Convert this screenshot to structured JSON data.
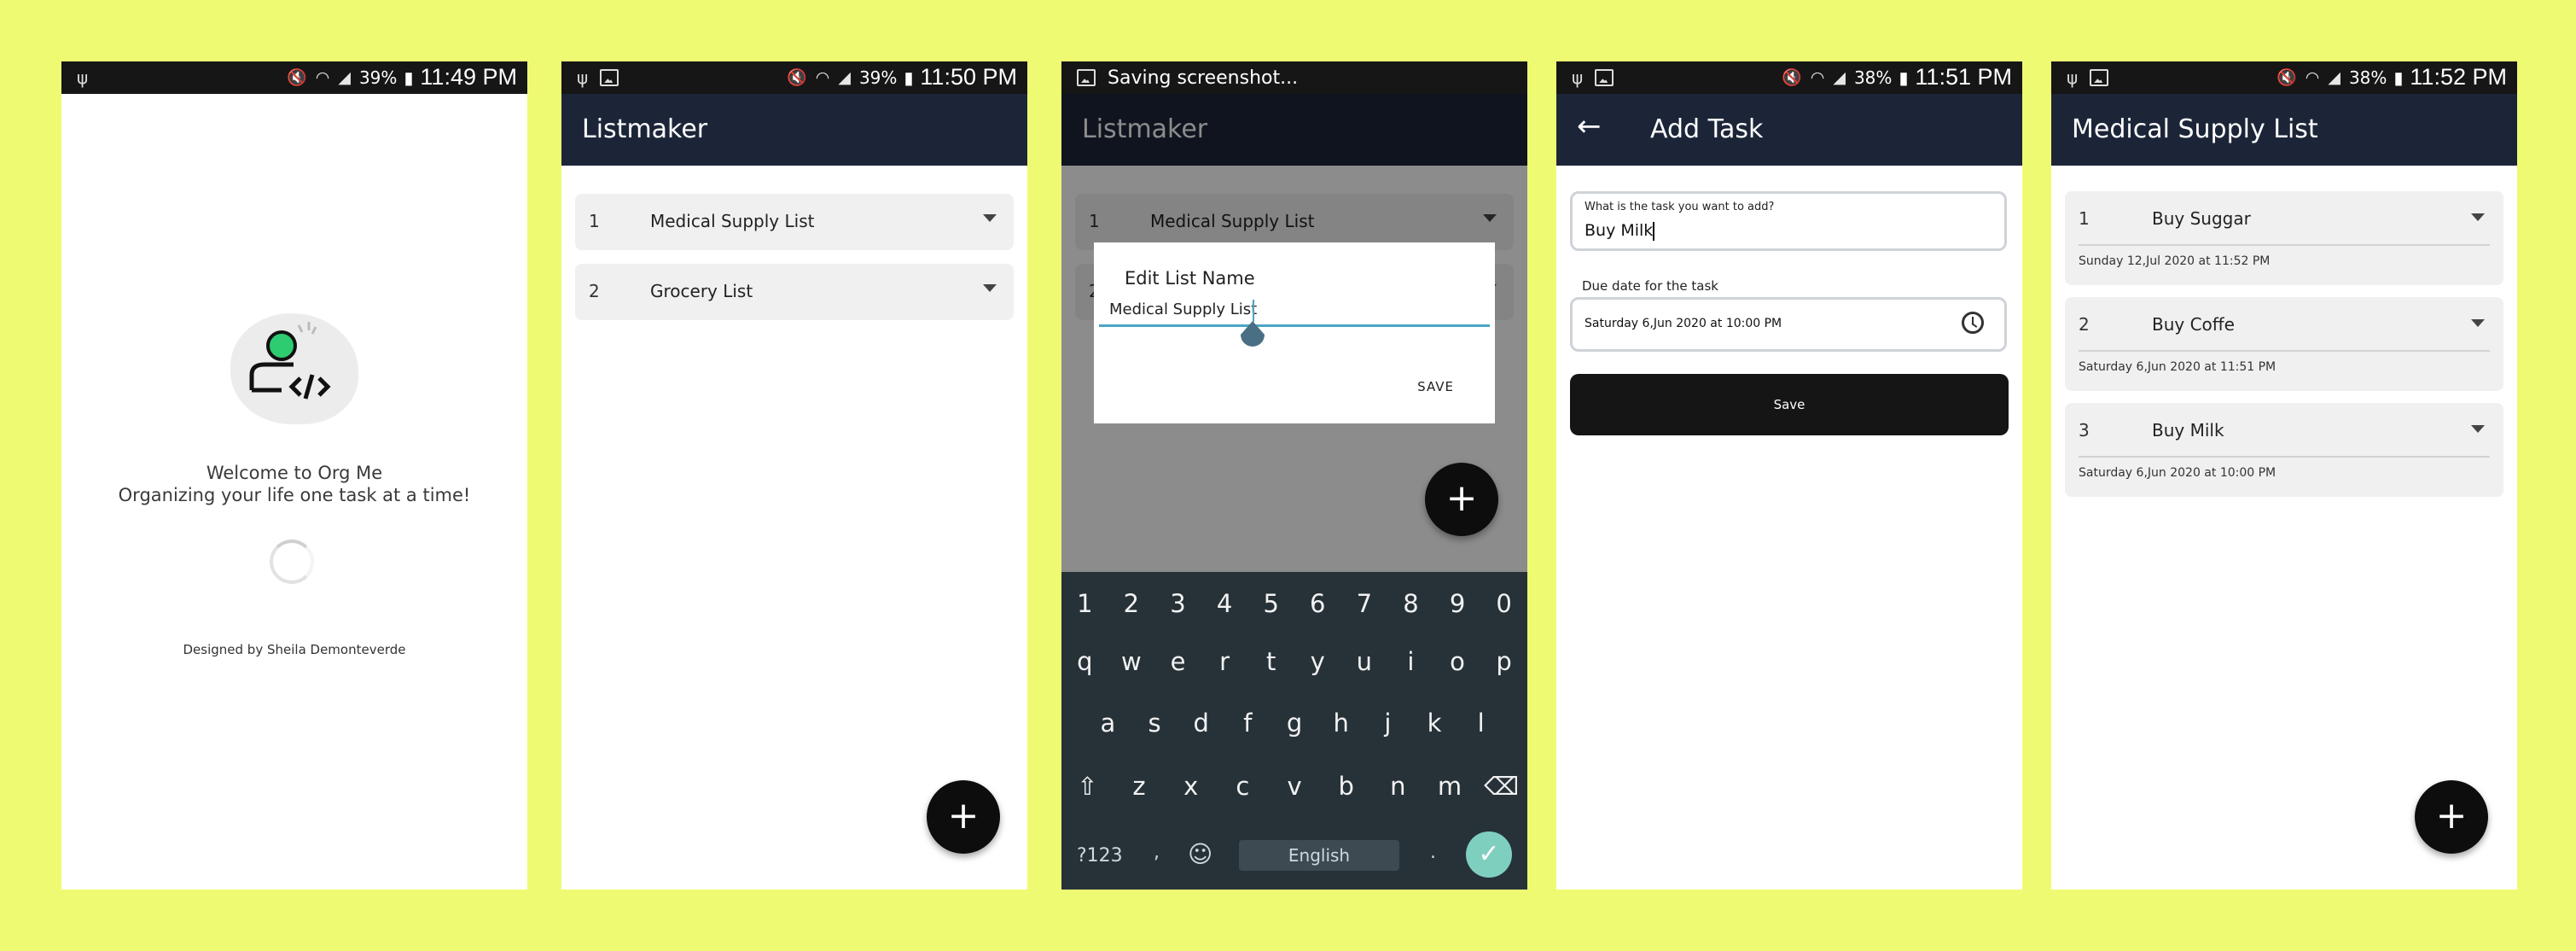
{
  "screen1": {
    "status": {
      "battery": "39%",
      "time": "11:49 PM"
    },
    "welcome_line1": "Welcome to Org Me",
    "welcome_line2": "Organizing your life one task at a time!",
    "designed_by": "Designed by Sheila Demonteverde"
  },
  "screen2": {
    "status": {
      "battery": "39%",
      "time": "11:50 PM"
    },
    "title": "Listmaker",
    "lists": [
      {
        "num": "1",
        "name": "Medical Supply List"
      },
      {
        "num": "2",
        "name": "Grocery List"
      }
    ],
    "fab": "+"
  },
  "screen3": {
    "status_text": "Saving screenshot...",
    "title": "Listmaker",
    "lists": [
      {
        "num": "1",
        "name": "Medical Supply List"
      },
      {
        "num": "2",
        "name": ""
      }
    ],
    "dialog": {
      "title": "Edit List Name",
      "value": "Medical Supply List",
      "save": "SAVE"
    },
    "fab": "+",
    "keyboard": {
      "row_numbers": [
        "1",
        "2",
        "3",
        "4",
        "5",
        "6",
        "7",
        "8",
        "9",
        "0"
      ],
      "row1": [
        "q",
        "w",
        "e",
        "r",
        "t",
        "y",
        "u",
        "i",
        "o",
        "p"
      ],
      "row2": [
        "a",
        "s",
        "d",
        "f",
        "g",
        "h",
        "j",
        "k",
        "l"
      ],
      "row3": [
        "z",
        "x",
        "c",
        "v",
        "b",
        "n",
        "m"
      ],
      "symbols": "?123",
      "comma": ",",
      "space": "English",
      "period": "."
    }
  },
  "screen4": {
    "status": {
      "battery": "38%",
      "time": "11:51 PM"
    },
    "title": "Add Task",
    "task_label": "What is the task you want to add?",
    "task_value": "Buy Milk",
    "due_label": "Due date for the task",
    "due_value": "Saturday 6,Jun 2020  at  10:00 PM",
    "save": "Save"
  },
  "screen5": {
    "status": {
      "battery": "38%",
      "time": "11:52 PM"
    },
    "title": "Medical Supply List",
    "tasks": [
      {
        "num": "1",
        "name": "Buy Suggar",
        "date": "Sunday 12,Jul 2020  at  11:52 PM"
      },
      {
        "num": "2",
        "name": "Buy Coffe",
        "date": "Saturday 6,Jun 2020  at  11:51 PM"
      },
      {
        "num": "3",
        "name": "Buy Milk",
        "date": "Saturday 6,Jun 2020  at  10:00 PM"
      }
    ],
    "fab": "+"
  },
  "colors": {
    "background": "#eefb72",
    "appbar": "#1c2538",
    "statusbar": "#161616",
    "accent": "#4aa6c3",
    "button": "#151515"
  }
}
